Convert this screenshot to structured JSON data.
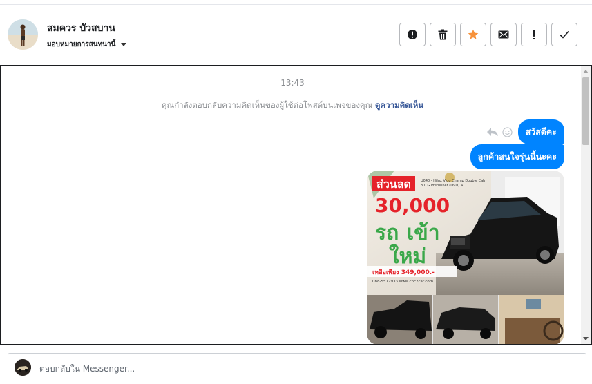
{
  "header": {
    "contact_name": "สมควร บัวสบาน",
    "assign_label": "มอบหมายการสนทนานี้",
    "toolbar": [
      {
        "icon": "alert-circle-icon",
        "name": "mark-spam-button"
      },
      {
        "icon": "trash-icon",
        "name": "delete-button"
      },
      {
        "icon": "star-icon",
        "name": "star-button"
      },
      {
        "icon": "envelope-icon",
        "name": "mark-unread-button"
      },
      {
        "icon": "exclamation-icon",
        "name": "follow-up-button"
      },
      {
        "icon": "check-icon",
        "name": "done-button"
      }
    ]
  },
  "chat": {
    "timestamp": "13:43",
    "notice_text": "คุณกำลังตอบกลับความคิดเห็นของผู้ใช้ต่อโพสต์บนเพจของคุณ",
    "notice_link": "ดูความคิดเห็น",
    "messages": [
      {
        "text": "สวัสดีคะ"
      },
      {
        "text": "ลูกค้าสนใจรุ่นนี้นะคะ"
      }
    ],
    "image_ad": {
      "badge": "ส่วนลด",
      "amount": "30,000",
      "headline_line1": "รถ",
      "headline_line2": "เข้า",
      "headline_line3": "ใหม่",
      "model_line1": "U040 - Hilux Vigo Champ Double Cab",
      "model_line2": "3.0 G Prerunner (DVD) AT",
      "price": "เหลือเพียง 349,000.-",
      "contact": "088-5577933 www.chc2car.com"
    }
  },
  "composer": {
    "placeholder": "ตอบกลับใน Messenger..."
  },
  "colors": {
    "accent": "#0084ff",
    "star": "#f7923b",
    "link": "#385898"
  }
}
